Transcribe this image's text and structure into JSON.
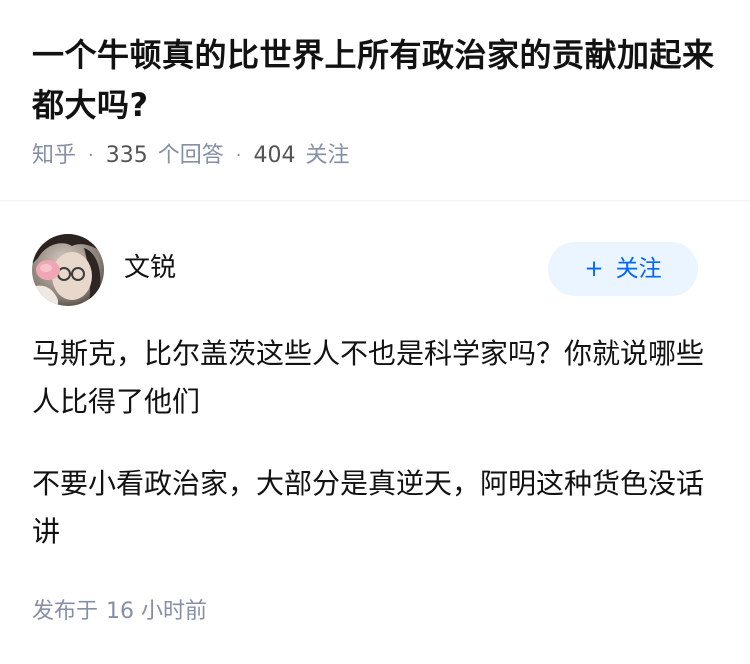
{
  "question": {
    "title": "一个牛顿真的比世界上所有政治家的贡献加起来都大吗?",
    "source": "知乎",
    "separator": "·",
    "answer_count": "335",
    "answer_label": "个回答",
    "follower_count": "404",
    "follower_label": "关注"
  },
  "author": {
    "name": "文锐",
    "avatar_icon": "avatar-photo",
    "follow_plus": "+",
    "follow_label": "关注",
    "accent_color": "#0066ff"
  },
  "answer": {
    "paragraphs": [
      "马斯克，比尔盖茨这些人不也是科学家吗？你就说哪些人比得了他们",
      "不要小看政治家，大部分是真逆天，阿明这种货色没话讲"
    ],
    "published_prefix": "发布于",
    "published_time": "16 小时前"
  }
}
